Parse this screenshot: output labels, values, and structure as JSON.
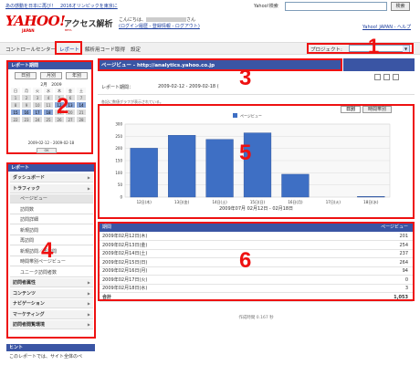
{
  "top": {
    "link": "あの感動を日本に再び！　2016オリンピックを東京に",
    "search_label": "Yahoo!検索",
    "search_button": "検索"
  },
  "brand": {
    "logo": "YAHOO!",
    "logo_sub": "JAPAN",
    "app_title": "アクセス解析",
    "beta": "BETA",
    "greeting_prefix": "こんにちは、",
    "greeting_suffix": "さん",
    "links": "(ログイン履歴 - 登録情報 - ログアウト)",
    "right_links": "Yahoo! JAPAN - ヘルプ"
  },
  "nav": {
    "items": [
      "コントロールセンター",
      "レポート",
      "解析用コード取得",
      "設定"
    ],
    "project_label": "プロジェクト:"
  },
  "calendar": {
    "header": "レポート期間",
    "tabs": [
      "日別",
      "月別",
      "年別"
    ],
    "month": "2月　2009",
    "weekdays": [
      "日",
      "月",
      "火",
      "水",
      "木",
      "金",
      "土"
    ],
    "range": "2009-02-12 - 2009-02-18",
    "ok": "OK"
  },
  "menu": {
    "header": "レポート",
    "items": [
      {
        "label": "ダッシュボード",
        "kind": "major"
      },
      {
        "label": "トラフィック",
        "kind": "major"
      },
      {
        "label": "ページビュー",
        "kind": "sub-selected"
      },
      {
        "label": "訪問数",
        "kind": "sub"
      },
      {
        "label": "訪問詳細",
        "kind": "sub"
      },
      {
        "label": "新規訪問",
        "kind": "sub"
      },
      {
        "label": "再訪問",
        "kind": "sub"
      },
      {
        "label": "新規訪問／再訪問",
        "kind": "sub"
      },
      {
        "label": "時間帯別ページビュー",
        "kind": "sub"
      },
      {
        "label": "ユニーク訪問者数",
        "kind": "sub"
      },
      {
        "label": "訪問者属性",
        "kind": "major"
      },
      {
        "label": "コンテンツ",
        "kind": "major"
      },
      {
        "label": "ナビゲーション",
        "kind": "major"
      },
      {
        "label": "マーケティング",
        "kind": "major"
      },
      {
        "label": "訪問者閲覧環境",
        "kind": "major"
      }
    ],
    "hint_header": "ヒント",
    "hint_text": "このレポートでは、サイト全体のペ"
  },
  "main": {
    "title": "ページビュー - http://analytics.yahoo.co.jp",
    "period_label": "レポート期間：",
    "period_value": "2009-02-12 - 2009-02-18 (",
    "note": "各記に数値グラフが表示されている。",
    "tabs": [
      "日別",
      "時間帯別"
    ],
    "chart_caption": "2009年07月 02月12日 - 02月18日",
    "process_time": "作成時間 0.167 秒"
  },
  "table": {
    "col1": "期間",
    "col2": "ページビュー",
    "rows": [
      {
        "date": "2009年02月12日(木)",
        "value": "201"
      },
      {
        "date": "2009年02月13日(金)",
        "value": "254"
      },
      {
        "date": "2009年02月14日(土)",
        "value": "237"
      },
      {
        "date": "2009年02月15日(日)",
        "value": "264"
      },
      {
        "date": "2009年02月16日(月)",
        "value": "94"
      },
      {
        "date": "2009年02月17日(火)",
        "value": "0"
      },
      {
        "date": "2009年02月18日(水)",
        "value": "3"
      }
    ],
    "total_label": "合計",
    "total_value": "1,053"
  },
  "callouts": [
    "1",
    "2",
    "3",
    "4",
    "5",
    "6"
  ],
  "chart_data": {
    "type": "bar",
    "categories": [
      "12日(木)",
      "13日(金)",
      "14日(土)",
      "15日(日)",
      "16日(月)",
      "17日(火)",
      "18日(水)"
    ],
    "series": [
      {
        "name": "ページビュー",
        "values": [
          201,
          254,
          237,
          264,
          94,
          0,
          3
        ]
      }
    ],
    "yticks": [
      "0",
      "50",
      "100",
      "150",
      "200",
      "250",
      "300"
    ],
    "ylim": [
      0,
      300
    ],
    "grid": true,
    "legend_position": "top-center"
  },
  "colors": {
    "accent": "#3a55a4",
    "callout": "#ee1111",
    "bar": "#3e6fc4"
  }
}
